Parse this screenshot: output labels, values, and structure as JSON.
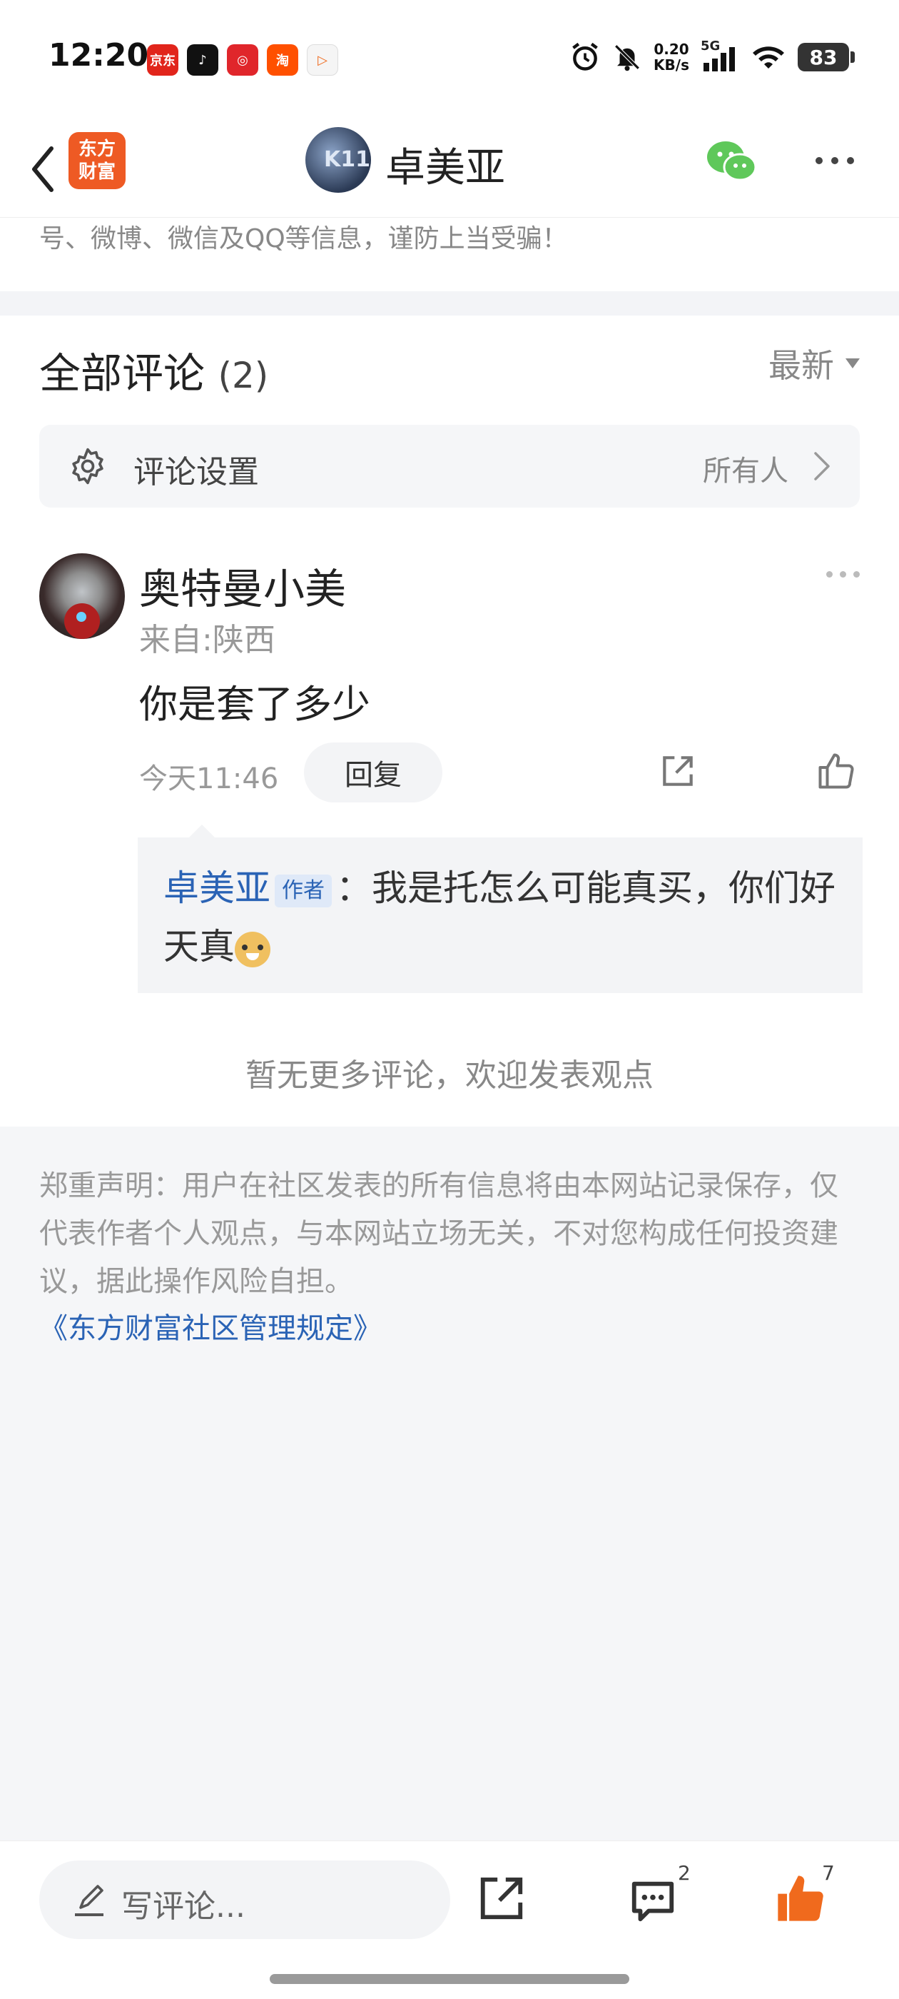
{
  "status_bar": {
    "time": "12:20",
    "net_speed_value": "0.20",
    "net_speed_unit": "KB/s",
    "signal_label": "5G",
    "battery": "83",
    "app_icons": [
      {
        "name": "jd-icon",
        "label": "京东",
        "color": "#e1251b"
      },
      {
        "name": "douyin-icon",
        "label": "♪",
        "color": "#111111"
      },
      {
        "name": "netease-music-icon",
        "label": "◎",
        "color": "#e0262b"
      },
      {
        "name": "taobao-icon",
        "label": "淘",
        "color": "#ff5000"
      },
      {
        "name": "video-app-icon",
        "label": "▷",
        "color": "#f5f5f5"
      }
    ]
  },
  "header": {
    "brand_line1": "东方",
    "brand_line2": "财富",
    "avatar_text": "K11",
    "title": "卓美亚"
  },
  "notice_tail": "号、微博、微信及QQ等信息，谨防上当受骗！",
  "comments_section": {
    "title": "全部评论",
    "count": "(2)",
    "sort_label": "最新",
    "settings": {
      "label": "评论设置",
      "value": "所有人"
    }
  },
  "comment": {
    "author": "奥特曼小美",
    "location": "来自:陕西",
    "text": "你是套了多少",
    "time": "今天11:46",
    "reply_button": "回复",
    "reply": {
      "author": "卓美亚",
      "badge": "作者",
      "text": "：我是托怎么可能真买，你们好天真"
    }
  },
  "no_more_text": "暂无更多评论，欢迎发表观点",
  "disclaimer": "郑重声明：用户在社区发表的所有信息将由本网站记录保存，仅代表作者个人观点，与本网站立场无关，不对您构成任何投资建议，据此操作风险自担。",
  "rules_link": "《东方财富社区管理规定》",
  "bottom_bar": {
    "input_placeholder": "写评论...",
    "comment_count": "2",
    "like_count": "7"
  },
  "colors": {
    "accent_blue": "#2a63b5",
    "like_orange": "#f06a1d",
    "wechat_green": "#5fc85a"
  }
}
